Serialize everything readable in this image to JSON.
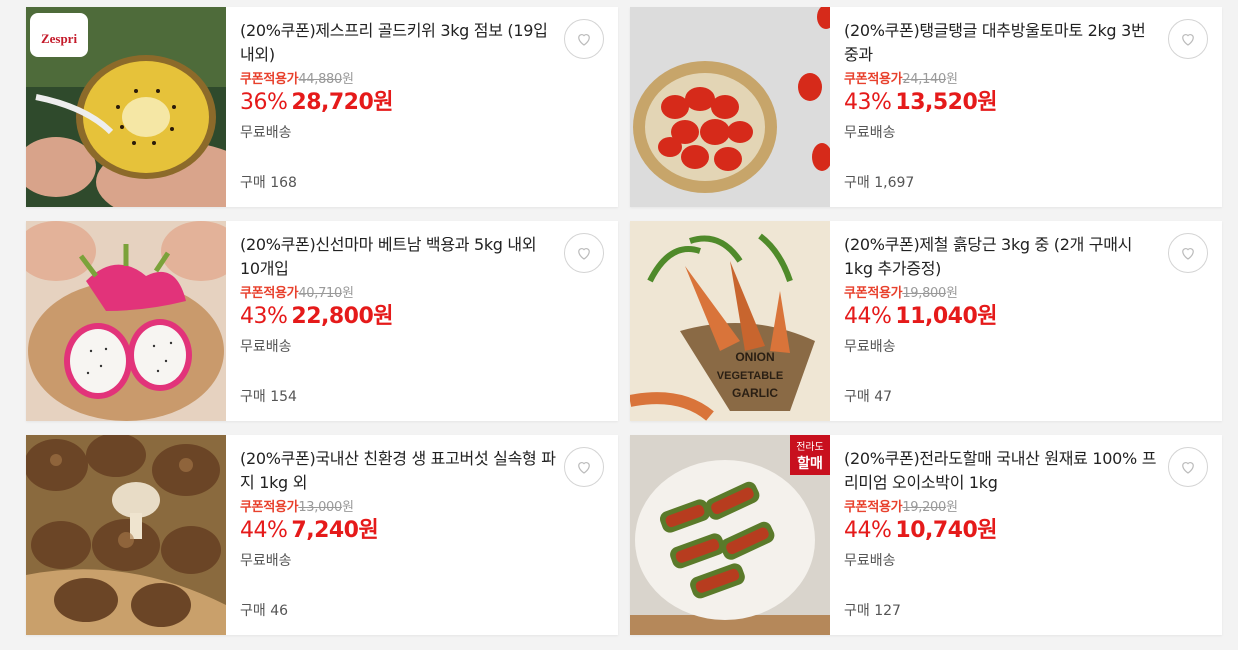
{
  "products": [
    {
      "title": "(20%쿠폰)제스프리 골드키위 3kg 점보 (19입 내외)",
      "coupon_label": "쿠폰적용가",
      "original_price": "44,880",
      "unit": "원",
      "discount": "36%",
      "price": "28,720원",
      "delivery": "무료배송",
      "purchase": "구매 168",
      "image": "kiwi",
      "logo_text": "Zespri"
    },
    {
      "title": "(20%쿠폰)탱글탱글 대추방울토마토 2kg 3번 중과",
      "coupon_label": "쿠폰적용가",
      "original_price": "24,140",
      "unit": "원",
      "discount": "43%",
      "price": "13,520원",
      "delivery": "무료배송",
      "purchase": "구매 1,697",
      "image": "tomato"
    },
    {
      "title": "(20%쿠폰)신선마마 베트남 백용과 5kg 내외 10개입",
      "coupon_label": "쿠폰적용가",
      "original_price": "40,710",
      "unit": "원",
      "discount": "43%",
      "price": "22,800원",
      "delivery": "무료배송",
      "purchase": "구매 154",
      "image": "dragonfruit"
    },
    {
      "title": "(20%쿠폰)제철 흙당근 3kg 중 (2개 구매시 1kg 추가증정)",
      "coupon_label": "쿠폰적용가",
      "original_price": "19,800",
      "unit": "원",
      "discount": "44%",
      "price": "11,040원",
      "delivery": "무료배송",
      "purchase": "구매 47",
      "image": "carrot",
      "sack_text": [
        "ONION",
        "VEGETABLE",
        "GARLIC"
      ]
    },
    {
      "title": "(20%쿠폰)국내산 친환경 생 표고버섯 실속형 파지 1kg 외",
      "coupon_label": "쿠폰적용가",
      "original_price": "13,000",
      "unit": "원",
      "discount": "44%",
      "price": "7,240원",
      "delivery": "무료배송",
      "purchase": "구매 46",
      "image": "mushroom"
    },
    {
      "title": "(20%쿠폰)전라도할매 국내산 원재료 100% 프리미엄 오이소박이 1kg",
      "coupon_label": "쿠폰적용가",
      "original_price": "19,200",
      "unit": "원",
      "discount": "44%",
      "price": "10,740원",
      "delivery": "무료배송",
      "purchase": "구매 127",
      "image": "kimchi",
      "badge_text": [
        "전라도",
        "할매"
      ]
    }
  ],
  "icons": {
    "wishlist": "heart-outline-icon"
  },
  "colors": {
    "accent_red": "#e51a1a",
    "coupon_red": "#e8412d",
    "muted": "#9a9a9a"
  }
}
